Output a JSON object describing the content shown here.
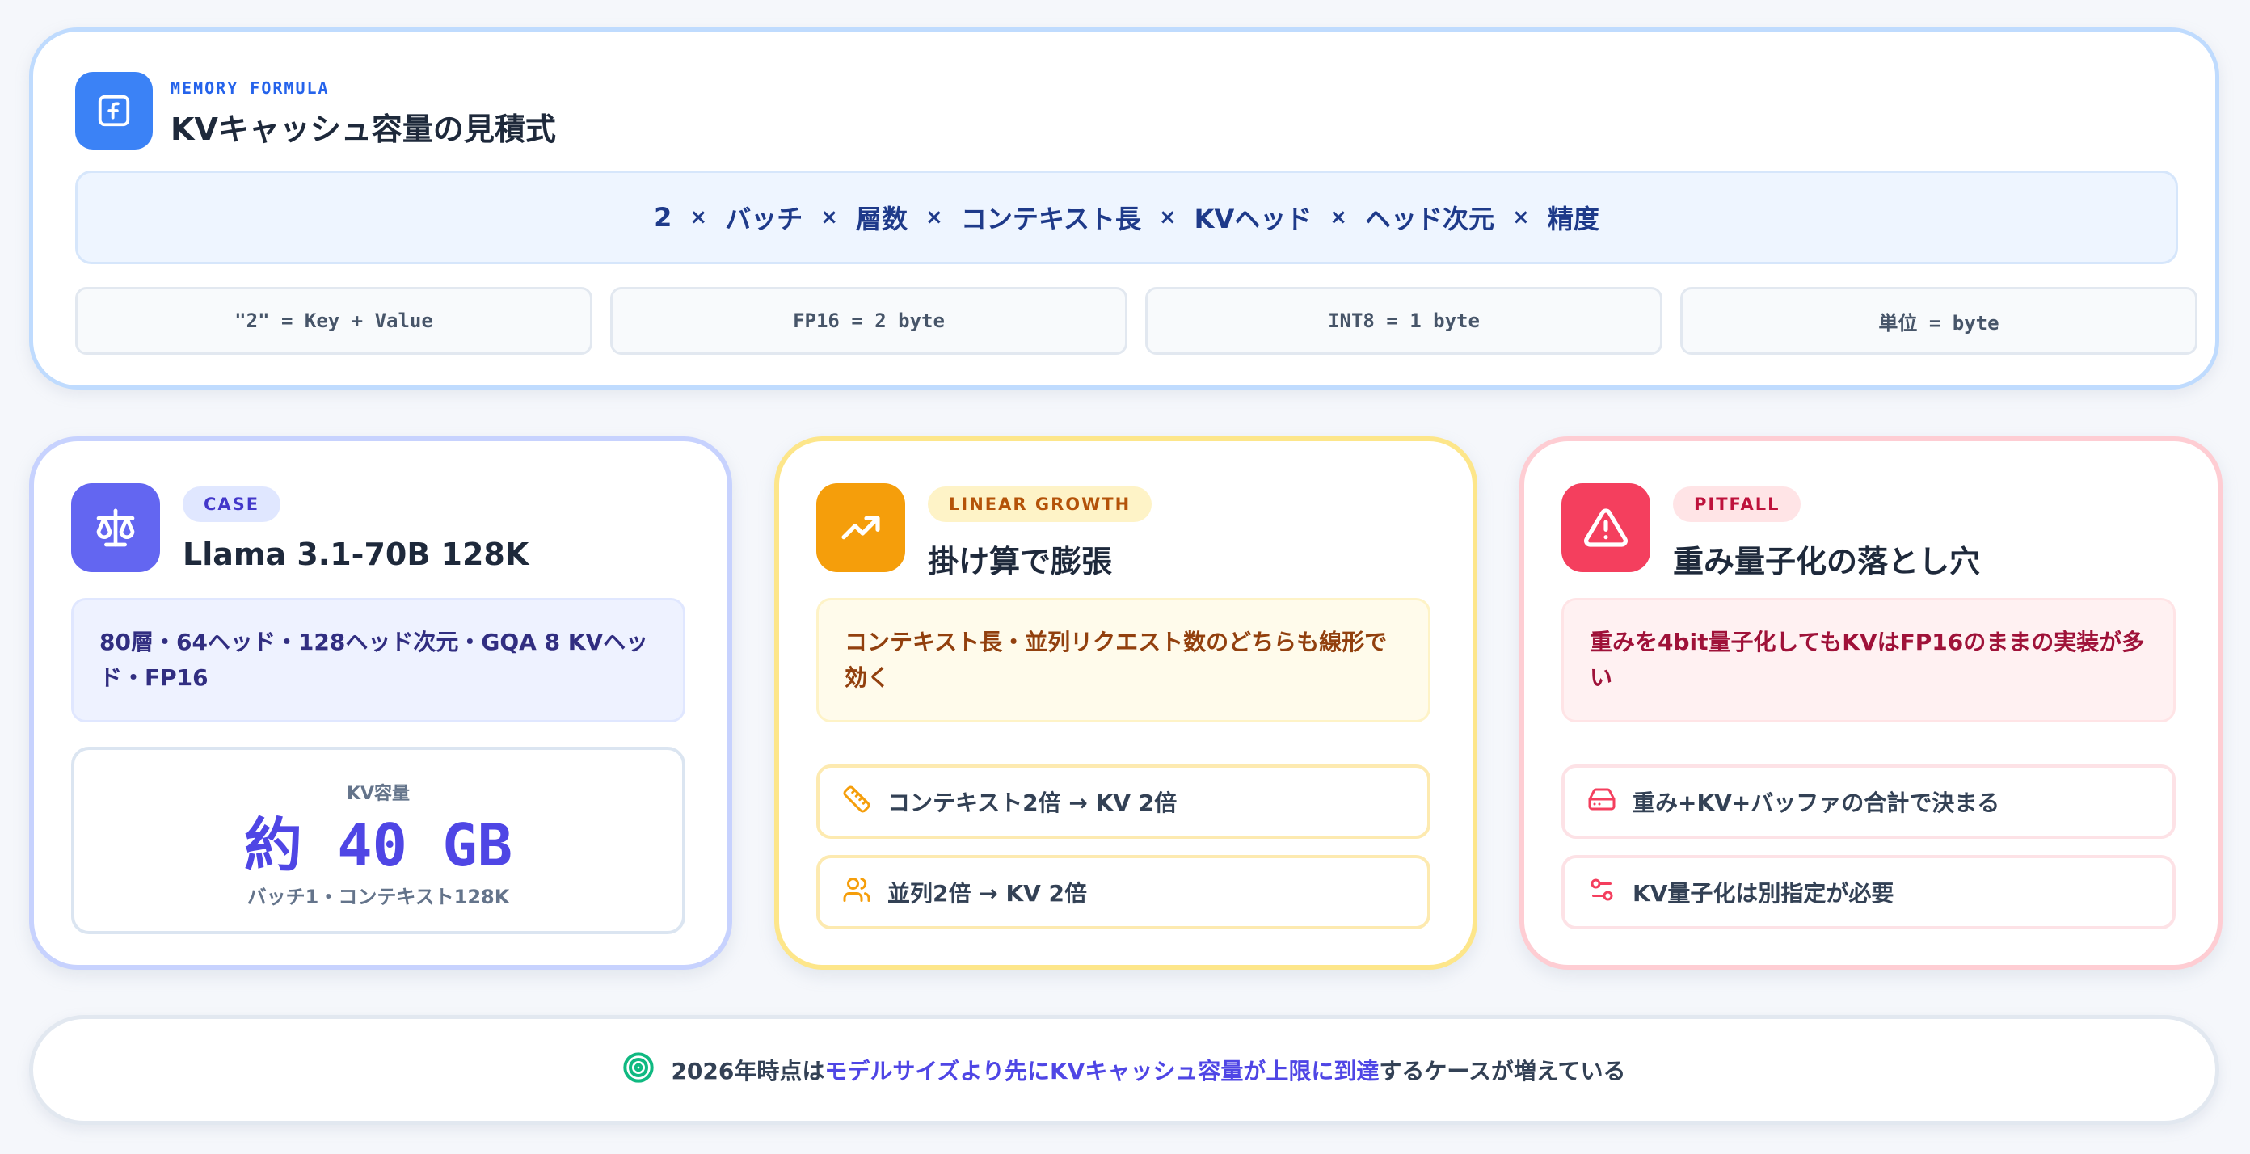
{
  "formula": {
    "eyebrow": "MEMORY FORMULA",
    "title": "KVキャッシュ容量の見積式",
    "terms": [
      "2",
      "バッチ",
      "層数",
      "コンテキスト長",
      "KVヘッド",
      "ヘッド次元",
      "精度"
    ],
    "operator": "×",
    "notes": [
      "\"2\" = Key + Value",
      "FP16 = 2 byte",
      "INT8 = 1 byte",
      "単位 = byte"
    ],
    "accent": "#3b82f6"
  },
  "case_card": {
    "tag": "CASE",
    "title": "Llama 3.1-70B 128K",
    "spec": "80層・64ヘッド・128ヘッド次元・GQA 8 KVヘッド・FP16",
    "kv_label": "KV容量",
    "kv_value": "約 40 GB",
    "kv_sub": "バッチ1・コンテキスト128K",
    "icon": "scale-icon",
    "accent": "#6366f1"
  },
  "growth_card": {
    "tag": "LINEAR GROWTH",
    "title": "掛け算で膨張",
    "desc": "コンテキスト長・並列リクエスト数のどちらも線形で効く",
    "items": [
      {
        "icon": "ruler-icon",
        "label": "コンテキスト2倍 → KV 2倍"
      },
      {
        "icon": "users-icon",
        "label": "並列2倍 → KV 2倍"
      }
    ],
    "icon": "trending-up-icon",
    "accent": "#f59e0b"
  },
  "pitfall_card": {
    "tag": "PITFALL",
    "title": "重み量子化の落とし穴",
    "desc": "重みを4bit量子化してもKVはFP16のままの実装が多い",
    "items": [
      {
        "icon": "hard-drive-icon",
        "label": "重み+KV+バッファの合計で決まる"
      },
      {
        "icon": "sliders-icon",
        "label": "KV量子化は別指定が必要"
      }
    ],
    "icon": "warning-icon",
    "accent": "#f43f5e"
  },
  "banner": {
    "prefix": "2026年時点は",
    "highlight": "モデルサイズより先にKVキャッシュ容量が上限に到達",
    "suffix": "するケースが増えている",
    "icon": "target-icon",
    "accent": "#10b981"
  }
}
